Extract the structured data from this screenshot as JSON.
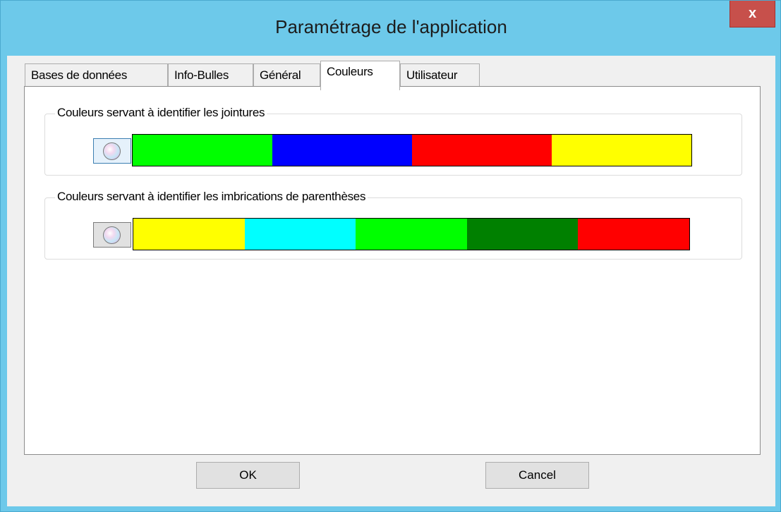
{
  "window": {
    "title": "Paramétrage de l'application",
    "close_label": "x"
  },
  "tabs": [
    {
      "label": "Bases de données",
      "active": false
    },
    {
      "label": "Info-Bulles",
      "active": false
    },
    {
      "label": "Général",
      "active": false
    },
    {
      "label": "Couleurs",
      "active": true
    },
    {
      "label": "Utilisateur",
      "active": false
    }
  ],
  "groups": {
    "jointures": {
      "label": "Couleurs servant à identifier les jointures",
      "colors": [
        "#00ff00",
        "#0000ff",
        "#ff0000",
        "#ffff00"
      ]
    },
    "parentheses": {
      "label": "Couleurs servant à identifier les imbrications de parenthèses",
      "colors": [
        "#ffff00",
        "#00ffff",
        "#00ff00",
        "#008000",
        "#ff0000"
      ]
    }
  },
  "buttons": {
    "ok": "OK",
    "cancel": "Cancel"
  },
  "icons": {
    "close": "close-icon",
    "color_picker": "color-wheel-icon"
  }
}
